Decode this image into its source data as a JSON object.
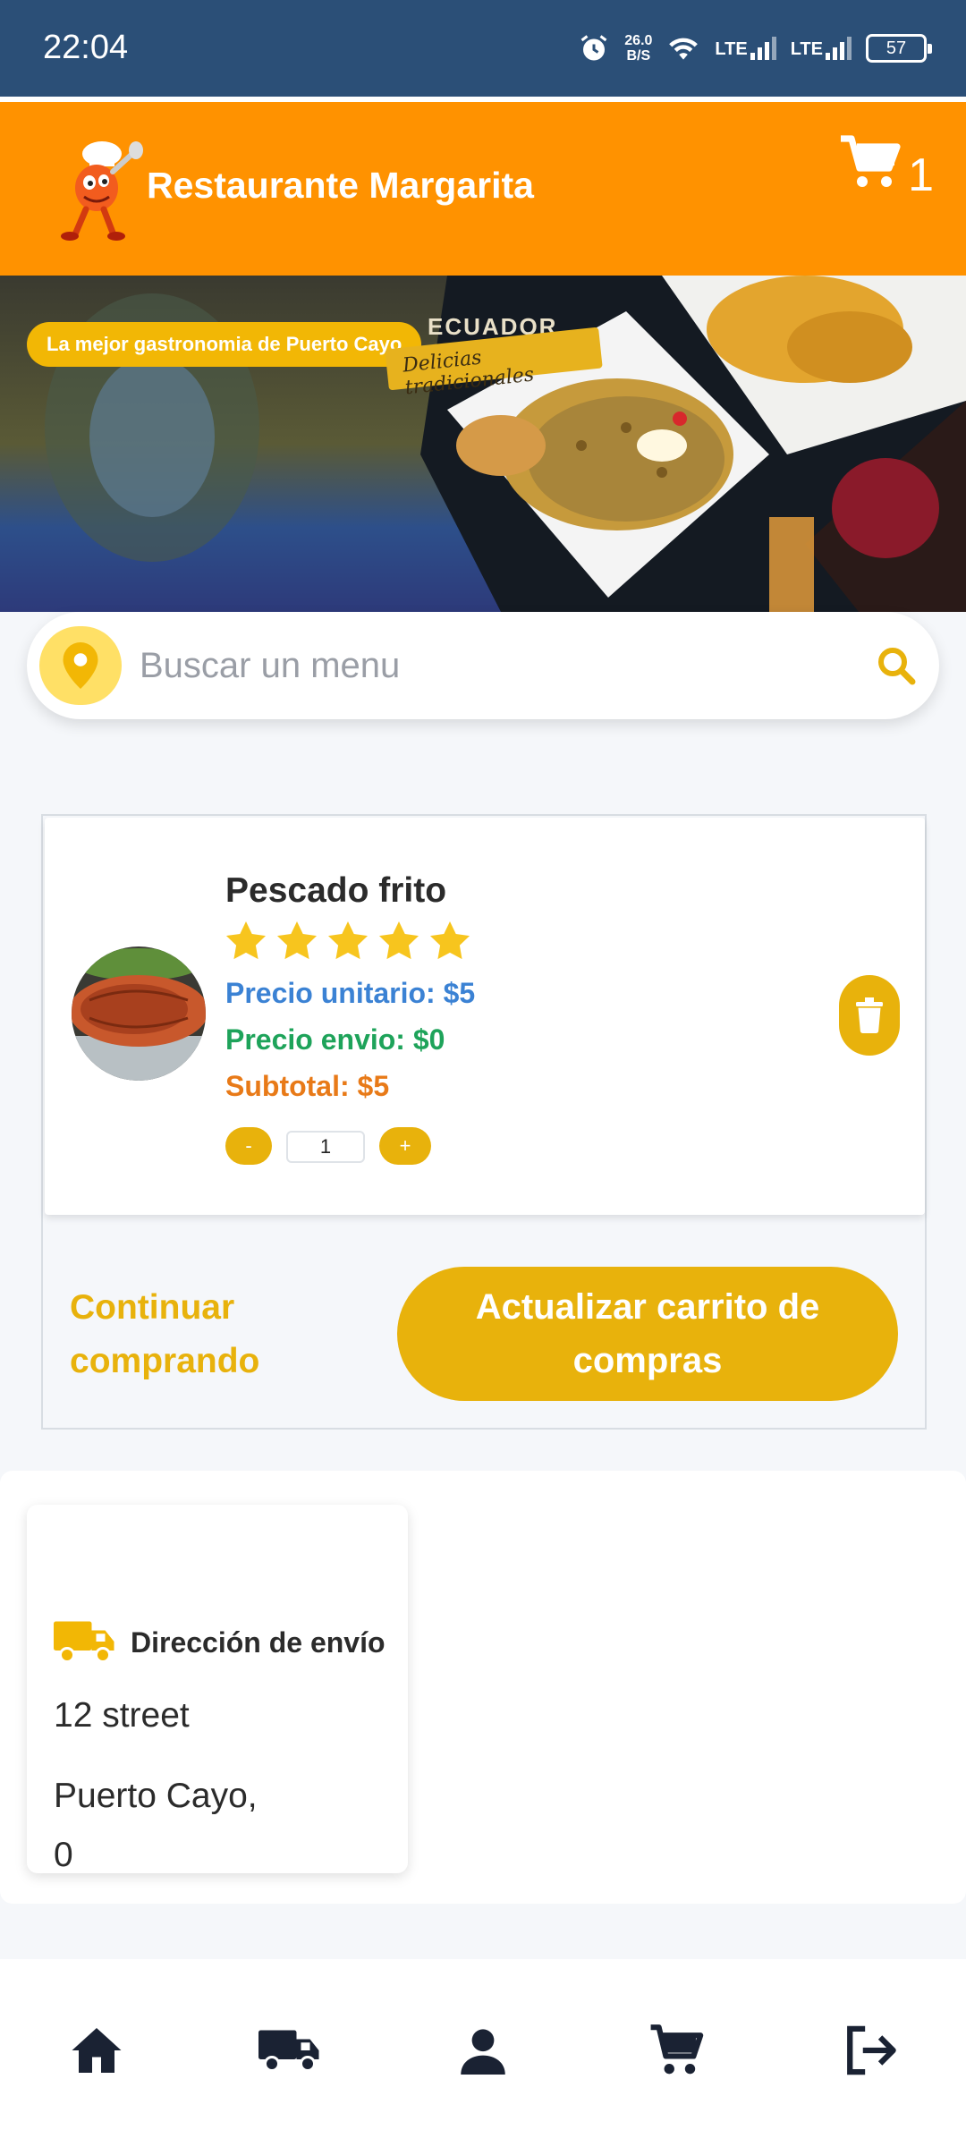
{
  "status_bar": {
    "time": "22:04",
    "net_speed_value": "26.0",
    "net_speed_unit": "B/S",
    "network_1": "LTE",
    "network_2": "LTE",
    "battery": "57"
  },
  "header": {
    "title": "Restaurante Margarita",
    "cart_count": "1"
  },
  "banner": {
    "tagline": "La mejor gastronomia de Puerto Cayo",
    "country": "ECUADOR",
    "subtitle": "Delicias tradicionales"
  },
  "search": {
    "placeholder": "Buscar un menu"
  },
  "cart_item": {
    "name": "Pescado frito",
    "rating": 5,
    "unit_price": "Precio unitario: $5",
    "shipping_price": "Precio envio: $0",
    "subtotal": "Subtotal: $5",
    "quantity": "1",
    "minus_label": "-",
    "plus_label": "+"
  },
  "actions": {
    "continue_label": "Continuar comprando",
    "update_label": "Actualizar carrito de compras"
  },
  "shipping": {
    "title": "Dirección de envío",
    "street": "12 street",
    "city": "Puerto Cayo,",
    "zip": "0"
  },
  "colors": {
    "status_bar": "#2b4f77",
    "header": "#ff9200",
    "accent": "#e8b20c",
    "unit_price": "#3b82d4",
    "shipping_price": "#1ea35a",
    "subtotal": "#e87a18",
    "nav_icons": "#1a2233"
  },
  "bottom_nav": [
    "home-icon",
    "truck-icon",
    "user-icon",
    "cart-icon",
    "logout-icon"
  ]
}
